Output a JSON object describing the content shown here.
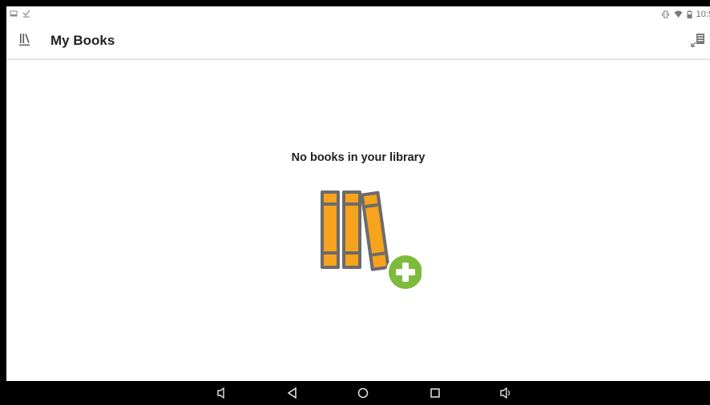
{
  "status_bar": {
    "time": "10:5",
    "left_icons": [
      "screenshot-icon",
      "download-done-icon"
    ],
    "right_icons": [
      "vibrate-icon",
      "wifi-icon",
      "battery-icon"
    ]
  },
  "app_bar": {
    "title": "My Books",
    "nav_icon": "library-icon",
    "action_icon": "add-to-library-icon"
  },
  "empty_state": {
    "message": "No books in your library",
    "illustration": "books-add-icon",
    "colors": {
      "book": "#f6a31d",
      "book_outline": "#6b6b6b",
      "plus": "#7dbb3d"
    }
  },
  "nav_bar": {
    "buttons": [
      "volume-down-icon",
      "back-icon",
      "home-icon",
      "recents-icon",
      "volume-up-icon"
    ]
  }
}
